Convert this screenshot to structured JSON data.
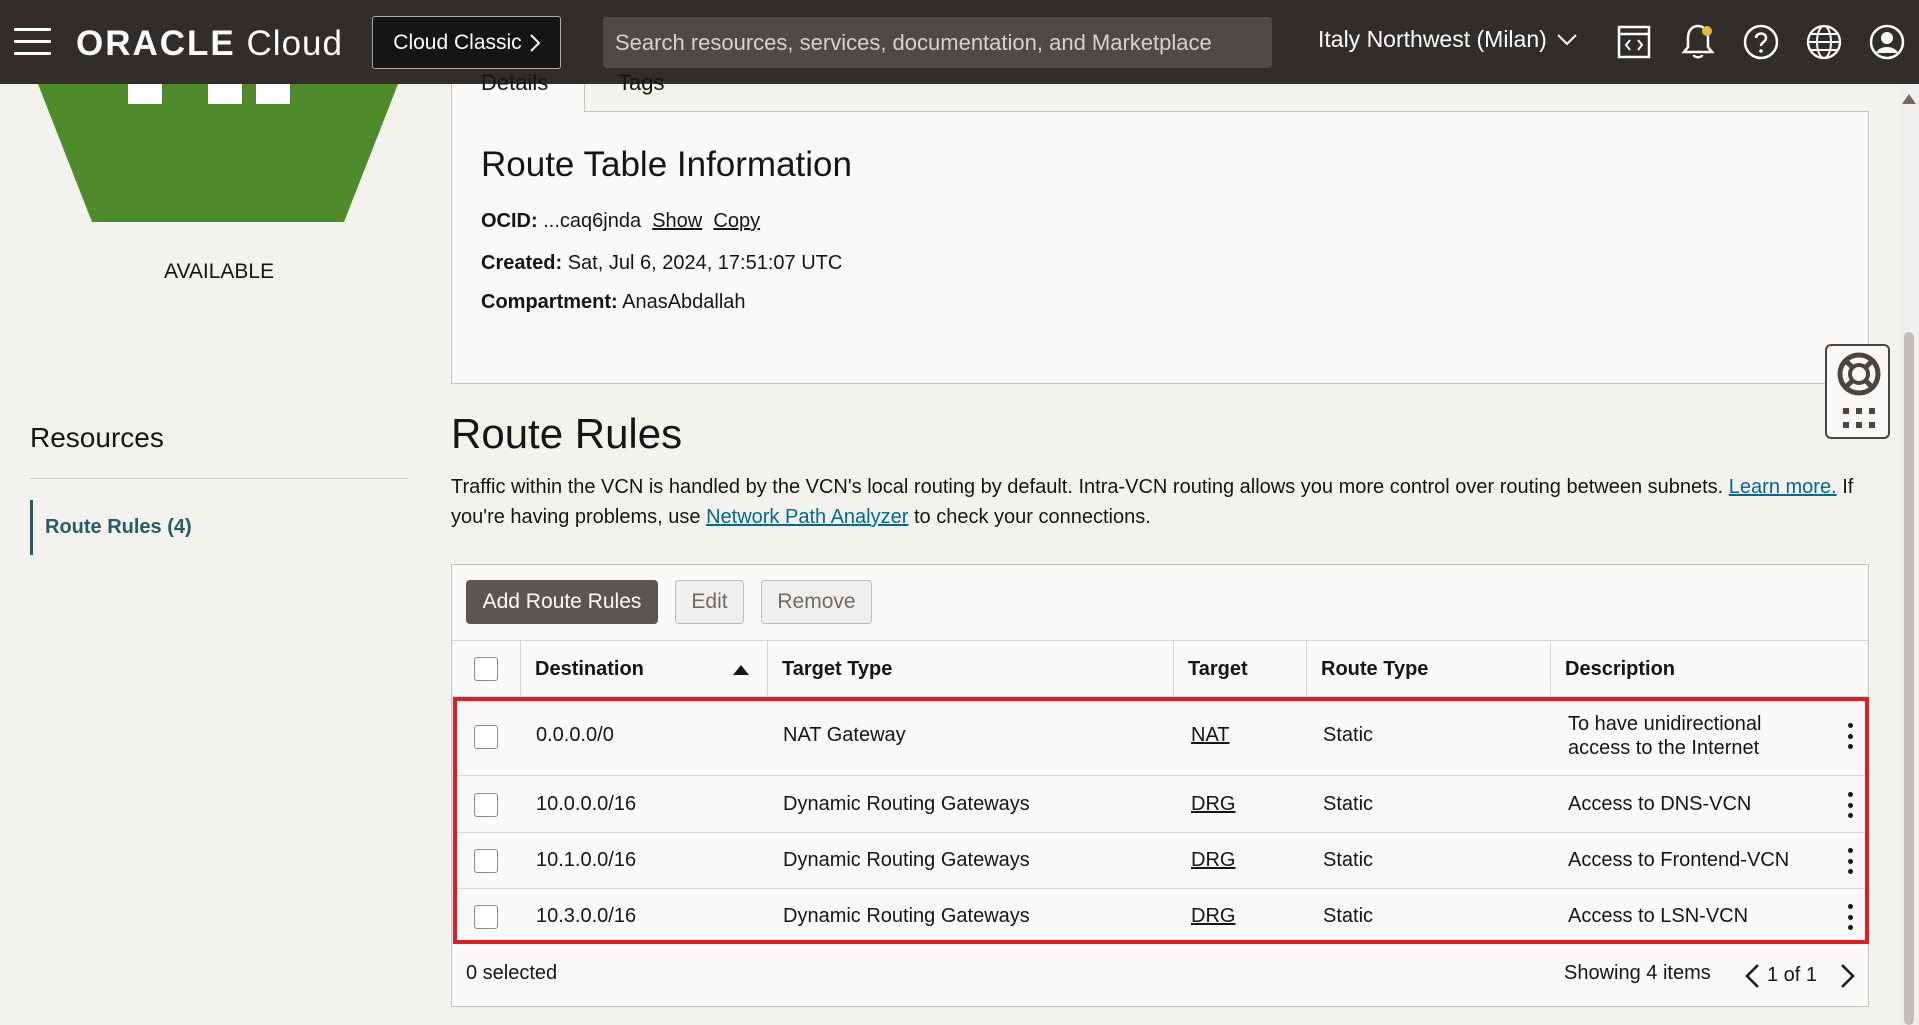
{
  "topbar": {
    "logo_brand": "ORACLE",
    "logo_product": "Cloud",
    "classic_label": "Cloud Classic",
    "search_placeholder": "Search resources, services, documentation, and Marketplace",
    "region_label": "Italy Northwest (Milan)",
    "icons": [
      "code-editor-icon",
      "bell-icon",
      "help-icon",
      "globe-icon",
      "user-icon"
    ]
  },
  "left_panel": {
    "status": "AVAILABLE",
    "resources_title": "Resources",
    "resources_item": "Route Rules (4)",
    "status_color": "#4f8a2b"
  },
  "details": {
    "tabs": [
      "Details",
      "Tags"
    ],
    "title": "Route Table Information",
    "ocid_label": "OCID:",
    "ocid_value": "...caq6jnda",
    "ocid_show": "Show",
    "ocid_copy": "Copy",
    "created_label": "Created:",
    "created_value": "Sat, Jul 6, 2024, 17:51:07 UTC",
    "compartment_label": "Compartment:",
    "compartment_value": "AnasAbdallah"
  },
  "route_rules": {
    "title": "Route Rules",
    "desc_part1": "Traffic within the VCN is handled by the VCN's local routing by default. Intra-VCN routing allows you more control over routing between subnets.",
    "desc_link1": "Learn more.",
    "desc_part2": "If you're having problems, use",
    "desc_link2": "Network Path Analyzer",
    "desc_part3": "to check your connections.",
    "buttons": {
      "add": "Add Route Rules",
      "edit": "Edit",
      "remove": "Remove"
    },
    "columns": [
      "Destination",
      "Target Type",
      "Target",
      "Route Type",
      "Description"
    ],
    "rows": [
      {
        "destination": "0.0.0.0/0",
        "target_type": "NAT Gateway",
        "target": "NAT",
        "route_type": "Static",
        "description": "To have unidirectional access to the Internet"
      },
      {
        "destination": "10.0.0.0/16",
        "target_type": "Dynamic Routing Gateways",
        "target": "DRG",
        "route_type": "Static",
        "description": "Access to DNS-VCN"
      },
      {
        "destination": "10.1.0.0/16",
        "target_type": "Dynamic Routing Gateways",
        "target": "DRG",
        "route_type": "Static",
        "description": "Access to Frontend-VCN"
      },
      {
        "destination": "10.3.0.0/16",
        "target_type": "Dynamic Routing Gateways",
        "target": "DRG",
        "route_type": "Static",
        "description": "Access to LSN-VCN"
      }
    ],
    "selected_text": "0 selected",
    "showing_text": "Showing 4 items",
    "page_text": "1 of 1",
    "highlight_color": "#e31b23"
  }
}
